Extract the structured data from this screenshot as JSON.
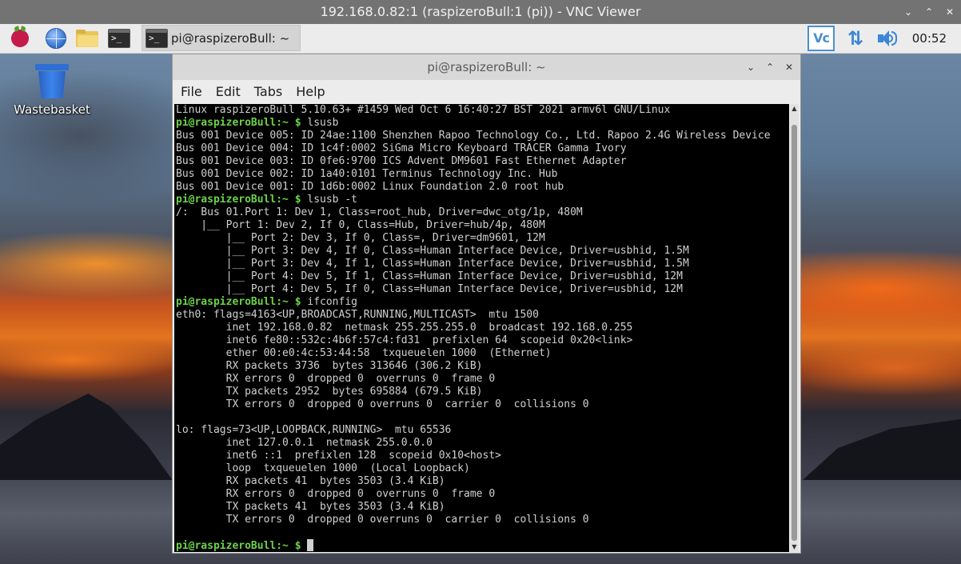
{
  "vnc": {
    "title": "192.168.0.82:1 (raspizeroBull:1 (pi)) - VNC Viewer",
    "controls": [
      "⌄",
      "⌃",
      "✕"
    ]
  },
  "taskbar": {
    "task_button_label": "pi@raspizeroBull: ~",
    "terminal_icon_glyph": ">_",
    "tray_vc_text": "Vc",
    "network_glyph": "⇅",
    "clock": "00:52"
  },
  "desktop": {
    "wastebasket_label": "Wastebasket"
  },
  "terminal": {
    "title": "pi@raspizeroBull: ~",
    "controls": [
      "⌄",
      "⌃",
      "✕"
    ],
    "menu": [
      "File",
      "Edit",
      "Tabs",
      "Help"
    ],
    "scroll_up_glyph": "▲",
    "scroll_down_glyph": "▼",
    "lines": [
      {
        "prompt": "",
        "text": "Linux raspizeroBull 5.10.63+ #1459 Wed Oct 6 16:40:27 BST 2021 armv6l GNU/Linux"
      },
      {
        "prompt": "pi@raspizeroBull:~ $",
        "text": " lsusb"
      },
      {
        "prompt": "",
        "text": "Bus 001 Device 005: ID 24ae:1100 Shenzhen Rapoo Technology Co., Ltd. Rapoo 2.4G Wireless Device"
      },
      {
        "prompt": "",
        "text": "Bus 001 Device 004: ID 1c4f:0002 SiGma Micro Keyboard TRACER Gamma Ivory"
      },
      {
        "prompt": "",
        "text": "Bus 001 Device 003: ID 0fe6:9700 ICS Advent DM9601 Fast Ethernet Adapter"
      },
      {
        "prompt": "",
        "text": "Bus 001 Device 002: ID 1a40:0101 Terminus Technology Inc. Hub"
      },
      {
        "prompt": "",
        "text": "Bus 001 Device 001: ID 1d6b:0002 Linux Foundation 2.0 root hub"
      },
      {
        "prompt": "pi@raspizeroBull:~ $",
        "text": " lsusb -t"
      },
      {
        "prompt": "",
        "text": "/:  Bus 01.Port 1: Dev 1, Class=root_hub, Driver=dwc_otg/1p, 480M"
      },
      {
        "prompt": "",
        "text": "    |__ Port 1: Dev 2, If 0, Class=Hub, Driver=hub/4p, 480M"
      },
      {
        "prompt": "",
        "text": "        |__ Port 2: Dev 3, If 0, Class=, Driver=dm9601, 12M"
      },
      {
        "prompt": "",
        "text": "        |__ Port 3: Dev 4, If 0, Class=Human Interface Device, Driver=usbhid, 1.5M"
      },
      {
        "prompt": "",
        "text": "        |__ Port 3: Dev 4, If 1, Class=Human Interface Device, Driver=usbhid, 1.5M"
      },
      {
        "prompt": "",
        "text": "        |__ Port 4: Dev 5, If 1, Class=Human Interface Device, Driver=usbhid, 12M"
      },
      {
        "prompt": "",
        "text": "        |__ Port 4: Dev 5, If 0, Class=Human Interface Device, Driver=usbhid, 12M"
      },
      {
        "prompt": "pi@raspizeroBull:~ $",
        "text": " ifconfig"
      },
      {
        "prompt": "",
        "text": "eth0: flags=4163<UP,BROADCAST,RUNNING,MULTICAST>  mtu 1500"
      },
      {
        "prompt": "",
        "text": "        inet 192.168.0.82  netmask 255.255.255.0  broadcast 192.168.0.255"
      },
      {
        "prompt": "",
        "text": "        inet6 fe80::532c:4b6f:57c4:fd31  prefixlen 64  scopeid 0x20<link>"
      },
      {
        "prompt": "",
        "text": "        ether 00:e0:4c:53:44:58  txqueuelen 1000  (Ethernet)"
      },
      {
        "prompt": "",
        "text": "        RX packets 3736  bytes 313646 (306.2 KiB)"
      },
      {
        "prompt": "",
        "text": "        RX errors 0  dropped 0  overruns 0  frame 0"
      },
      {
        "prompt": "",
        "text": "        TX packets 2952  bytes 695884 (679.5 KiB)"
      },
      {
        "prompt": "",
        "text": "        TX errors 0  dropped 0 overruns 0  carrier 0  collisions 0"
      },
      {
        "prompt": "",
        "text": ""
      },
      {
        "prompt": "",
        "text": "lo: flags=73<UP,LOOPBACK,RUNNING>  mtu 65536"
      },
      {
        "prompt": "",
        "text": "        inet 127.0.0.1  netmask 255.0.0.0"
      },
      {
        "prompt": "",
        "text": "        inet6 ::1  prefixlen 128  scopeid 0x10<host>"
      },
      {
        "prompt": "",
        "text": "        loop  txqueuelen 1000  (Local Loopback)"
      },
      {
        "prompt": "",
        "text": "        RX packets 41  bytes 3503 (3.4 KiB)"
      },
      {
        "prompt": "",
        "text": "        RX errors 0  dropped 0  overruns 0  frame 0"
      },
      {
        "prompt": "",
        "text": "        TX packets 41  bytes 3503 (3.4 KiB)"
      },
      {
        "prompt": "",
        "text": "        TX errors 0  dropped 0 overruns 0  carrier 0  collisions 0"
      },
      {
        "prompt": "",
        "text": ""
      },
      {
        "prompt": "pi@raspizeroBull:~ $",
        "text": " "
      }
    ]
  }
}
